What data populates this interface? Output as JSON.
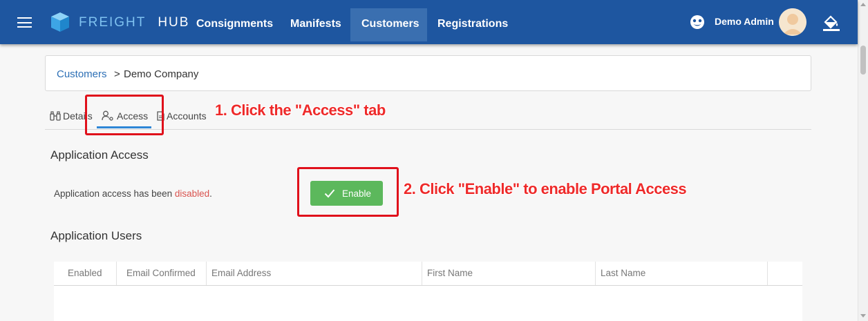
{
  "header": {
    "logo_word1": "FREIGHT",
    "logo_word2": "HUB",
    "nav": [
      "Consignments",
      "Manifests",
      "Customers",
      "Registrations"
    ],
    "active_nav": "Customers",
    "user_name": "Demo Admin"
  },
  "breadcrumb": {
    "parent": "Customers",
    "separator": ">",
    "current": "Demo Company"
  },
  "tabs": [
    {
      "label": "Details",
      "icon": "binoculars-icon"
    },
    {
      "label": "Access",
      "icon": "user-key-icon"
    },
    {
      "label": "Accounts",
      "icon": "document-icon"
    }
  ],
  "active_tab": "Access",
  "access": {
    "title": "Application Access",
    "status_prefix": "Application access has been ",
    "status_value": "disabled",
    "status_suffix": ".",
    "enable_label": "Enable"
  },
  "users": {
    "title": "Application Users",
    "columns": [
      "Enabled",
      "Email Confirmed",
      "Email Address",
      "First Name",
      "Last Name"
    ]
  },
  "annotations": {
    "step1": "1. Click the \"Access\" tab",
    "step2": "2. Click \"Enable\" to enable Portal Access"
  },
  "colors": {
    "navbar": "#1e56a0",
    "active_nav": "#3a6fb0",
    "enable_button": "#5cb85c",
    "disabled_text": "#d9534f",
    "annotation": "#e0101b",
    "tab_underline": "#2e86d6",
    "link": "#2c6fb5"
  }
}
